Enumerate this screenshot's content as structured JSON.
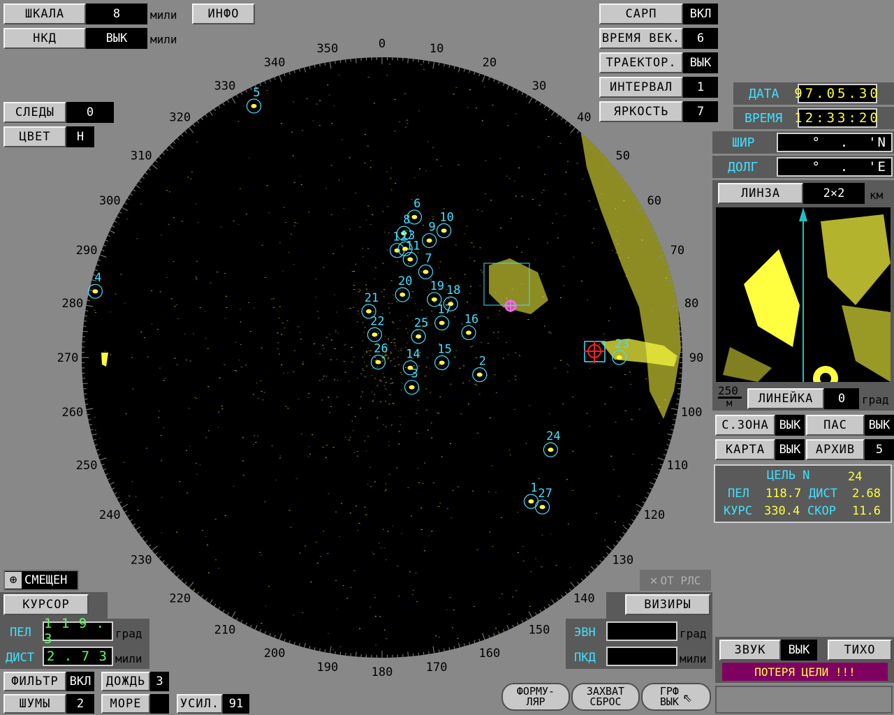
{
  "top_left": {
    "scale_btn": "ШКАЛА",
    "scale_val": "8",
    "scale_unit": "мили",
    "info_btn": "ИНФО",
    "nkd_btn": "НКД",
    "nkd_val": "ВЫК",
    "nkd_unit": "мили",
    "traces_btn": "СЛЕДЫ",
    "traces_val": "0",
    "color_btn": "ЦВЕТ",
    "color_val": "Н"
  },
  "top_right": {
    "sarp_btn": "САРП",
    "sarp_val": "ВКЛ",
    "vector_time_btn": "ВРЕМЯ ВЕК.",
    "vector_time_val": "6",
    "trajectory_btn": "ТРАЕКТОР.",
    "trajectory_val": "ВЫК",
    "interval_btn": "ИНТЕРВАЛ",
    "interval_val": "1",
    "brightness_btn": "ЯРКОСТЬ",
    "brightness_val": "7",
    "date_label": "ДАТА",
    "date_val": "97.05.30",
    "time_label": "ВРЕМЯ",
    "time_val": "12:33:20",
    "lat_label": "ШИР",
    "lat_val": "°  .  'N",
    "lon_label": "ДОЛГ",
    "lon_val": "°  .  'E"
  },
  "lens": {
    "btn": "ЛИНЗА",
    "val": "2×2",
    "unit": "км",
    "scale_value": "250",
    "scale_unit": "м",
    "ruler_btn": "ЛИНЕЙКА",
    "ruler_val": "0",
    "ruler_unit": "град"
  },
  "mode": {
    "szone_btn": "С.ЗОНА",
    "szone_val": "ВЫК",
    "pas_btn": "ПАС",
    "pas_val": "ВЫК",
    "map_btn": "КАРТА",
    "map_val": "ВЫК",
    "archive_btn": "АРХИВ",
    "archive_val": "5"
  },
  "target_info": {
    "title": "ЦЕЛЬ N",
    "number": "24",
    "bearing_label": "ПЕЛ",
    "bearing": "118.7",
    "dist_label": "ДИСТ",
    "dist": "2.68",
    "course_label": "КУРС",
    "course": "330.4",
    "speed_label": "СКОР",
    "speed": "11.6"
  },
  "cursor": {
    "offset_btn": "СМЕЩЕН",
    "cursor_btn": "КУРСОР",
    "bearing_label": "ПЕЛ",
    "bearing_val": "1 1 9 . 3",
    "bearing_unit": "град",
    "dist_label": "ДИСТ",
    "dist_val": "2 . 7 3",
    "dist_unit": "мили"
  },
  "bottom_left": {
    "filter_btn": "ФИЛЬТР",
    "filter_val": "ВКЛ",
    "rain_btn": "ДОЖДЬ",
    "rain_val": "3",
    "noise_btn": "ШУМЫ",
    "noise_val": "2",
    "sea_btn": "МОРЕ",
    "sea_val": "",
    "gain_btn": "УСИЛ.",
    "gain_val": "91"
  },
  "bottom_right": {
    "from_rls": "ОТ РЛС",
    "visors_btn": "ВИЗИРЫ",
    "evn_label": "ЭВН",
    "evn_unit": "град",
    "pkd_label": "ПКД",
    "pkd_unit": "мили",
    "sound_btn": "ЗВУК",
    "sound_val": "ВЫК",
    "quiet_btn": "ТИХО",
    "alarm": "ПОТЕРЯ ЦЕЛИ !!!",
    "form_l1": "ФОРМУ-",
    "form_l2": "ЛЯР",
    "capture_l1": "ЗАХВАТ",
    "capture_l2": "СБРОС",
    "grf_l1": "ГРФ",
    "grf_l2": "ВЫК"
  },
  "radar": {
    "bearing_labels": [
      "0",
      "10",
      "20",
      "30",
      "40",
      "50",
      "60",
      "70",
      "80",
      "90",
      "100",
      "110",
      "120",
      "130",
      "140",
      "150",
      "160",
      "170",
      "180",
      "190",
      "200",
      "210",
      "220",
      "230",
      "240",
      "250",
      "260",
      "270",
      "280",
      "290",
      "300",
      "310",
      "320",
      "330",
      "340",
      "350"
    ],
    "targets": [
      {
        "id": "1",
        "bearing": 134,
        "distance_frac": 0.69
      },
      {
        "id": "2",
        "bearing": 100,
        "distance_frac": 0.33
      },
      {
        "id": "3",
        "bearing": 135,
        "distance_frac": 0.14
      },
      {
        "id": "4",
        "bearing": 283,
        "distance_frac": 0.98
      },
      {
        "id": "5",
        "bearing": 333,
        "distance_frac": 0.94
      },
      {
        "id": "6",
        "bearing": 13,
        "distance_frac": 0.48
      },
      {
        "id": "7",
        "bearing": 27,
        "distance_frac": 0.32
      },
      {
        "id": "8",
        "bearing": 10,
        "distance_frac": 0.42
      },
      {
        "id": "9",
        "bearing": 22,
        "distance_frac": 0.42
      },
      {
        "id": "10",
        "bearing": 26,
        "distance_frac": 0.47
      },
      {
        "id": "11",
        "bearing": 16,
        "distance_frac": 0.34
      },
      {
        "id": "12",
        "bearing": 8,
        "distance_frac": 0.36
      },
      {
        "id": "13",
        "bearing": 12,
        "distance_frac": 0.37
      },
      {
        "id": "14",
        "bearing": 110,
        "distance_frac": 0.1
      },
      {
        "id": "15",
        "bearing": 95,
        "distance_frac": 0.2
      },
      {
        "id": "16",
        "bearing": 74,
        "distance_frac": 0.3
      },
      {
        "id": "17",
        "bearing": 60,
        "distance_frac": 0.23
      },
      {
        "id": "18",
        "bearing": 52,
        "distance_frac": 0.29
      },
      {
        "id": "19",
        "bearing": 42,
        "distance_frac": 0.26
      },
      {
        "id": "20",
        "bearing": 18,
        "distance_frac": 0.22
      },
      {
        "id": "21",
        "bearing": 344,
        "distance_frac": 0.16
      },
      {
        "id": "22",
        "bearing": 342,
        "distance_frac": 0.08
      },
      {
        "id": "23",
        "bearing": 90,
        "distance_frac": 0.79
      },
      {
        "id": "24",
        "bearing": 118.7,
        "distance_frac": 0.64
      },
      {
        "id": "25",
        "bearing": 60,
        "distance_frac": 0.14
      },
      {
        "id": "26",
        "bearing": 220,
        "distance_frac": 0.02
      },
      {
        "id": "27",
        "bearing": 133,
        "distance_frac": 0.73
      }
    ]
  },
  "colors": {
    "echo": "#ffff40",
    "track": "#40e0ff",
    "background": "#888888",
    "alarm_bg": "#800060",
    "alarm_text": "#ffff40"
  }
}
